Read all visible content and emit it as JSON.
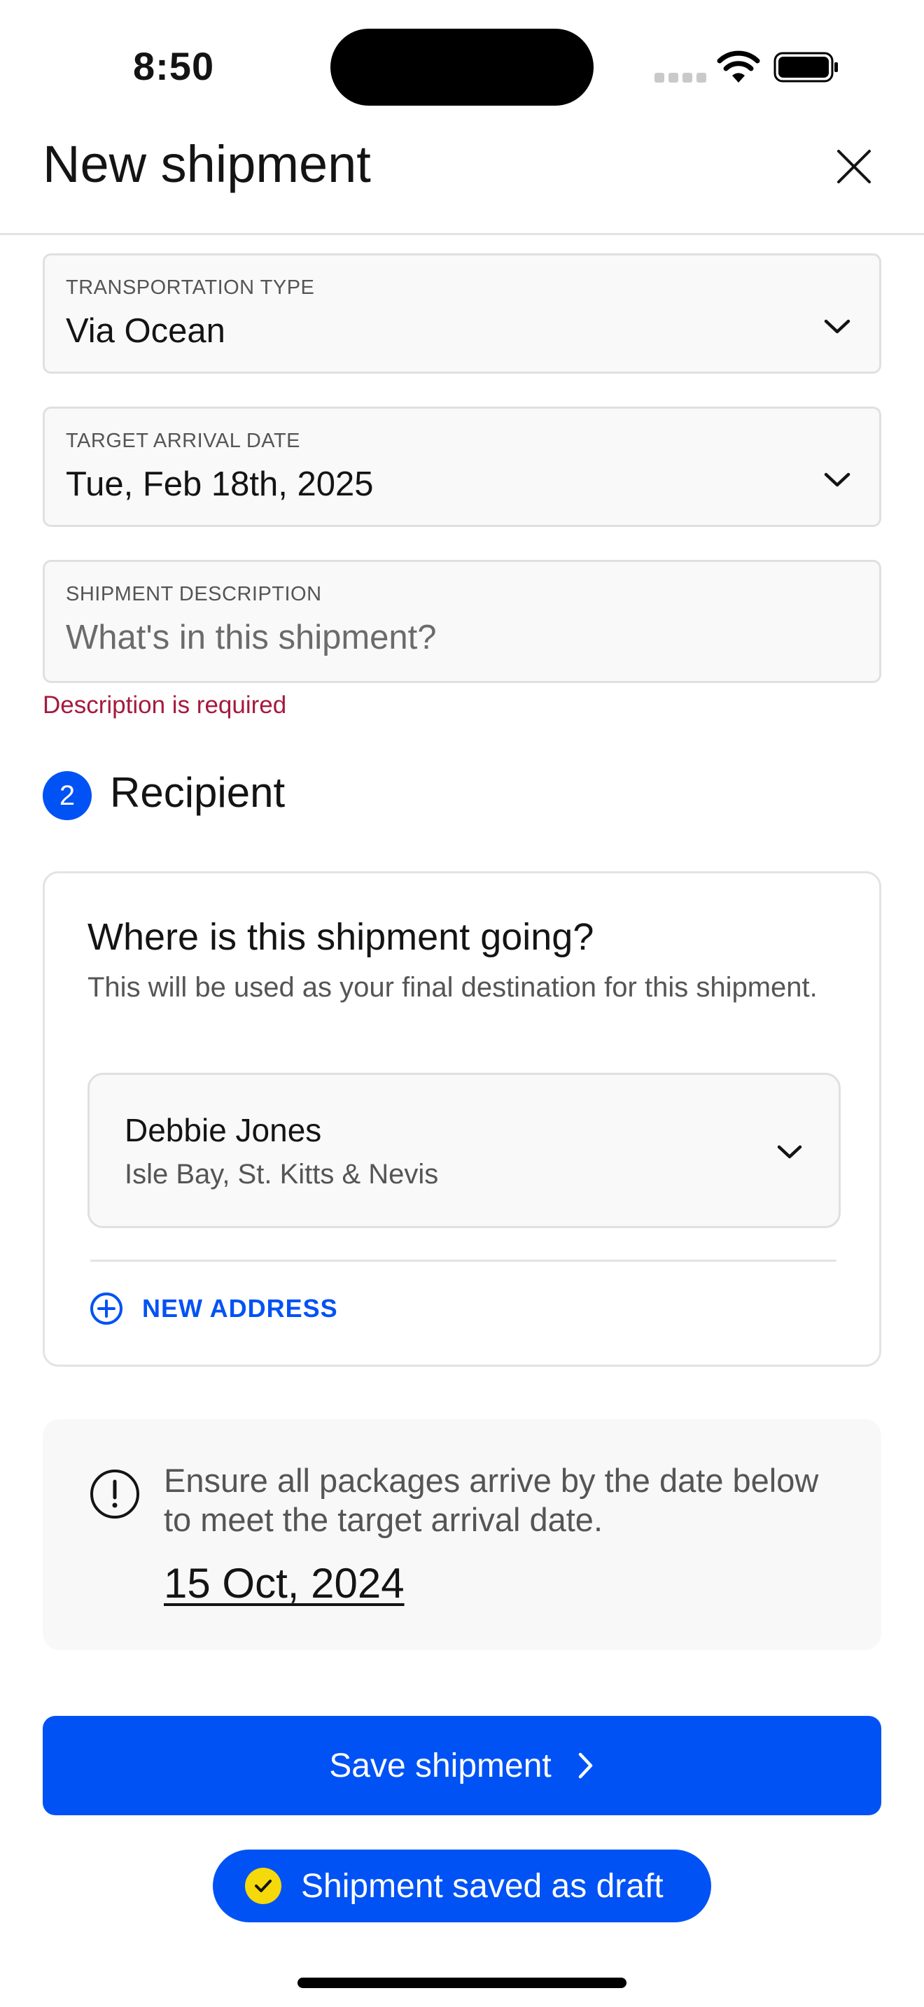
{
  "status_bar": {
    "time": "8:50"
  },
  "header": {
    "title": "New shipment"
  },
  "fields": {
    "transportation": {
      "label": "TRANSPORTATION TYPE",
      "value": "Via Ocean"
    },
    "arrival": {
      "label": "TARGET ARRIVAL DATE",
      "value": "Tue, Feb 18th, 2025"
    },
    "description": {
      "label": "SHIPMENT DESCRIPTION",
      "value": "",
      "placeholder": "What's in this shipment?",
      "error": "Description is required"
    }
  },
  "recipient": {
    "step": "2",
    "title": "Recipient",
    "card_title": "Where is this shipment going?",
    "card_subtitle": "This will be used as your final destination for this shipment.",
    "address": {
      "name": "Debbie Jones",
      "location": "Isle Bay, St. Kitts & Nevis"
    },
    "new_address_label": "NEW ADDRESS"
  },
  "info": {
    "text": "Ensure all packages arrive by the date below to meet the target arrival date.",
    "date": "15 Oct, 2024"
  },
  "actions": {
    "save_label": "Save shipment"
  },
  "toast": {
    "label": "Shipment saved as draft"
  },
  "colors": {
    "primary": "#0052f5",
    "error": "#a51a3f",
    "toast_check": "#f5d90a"
  }
}
